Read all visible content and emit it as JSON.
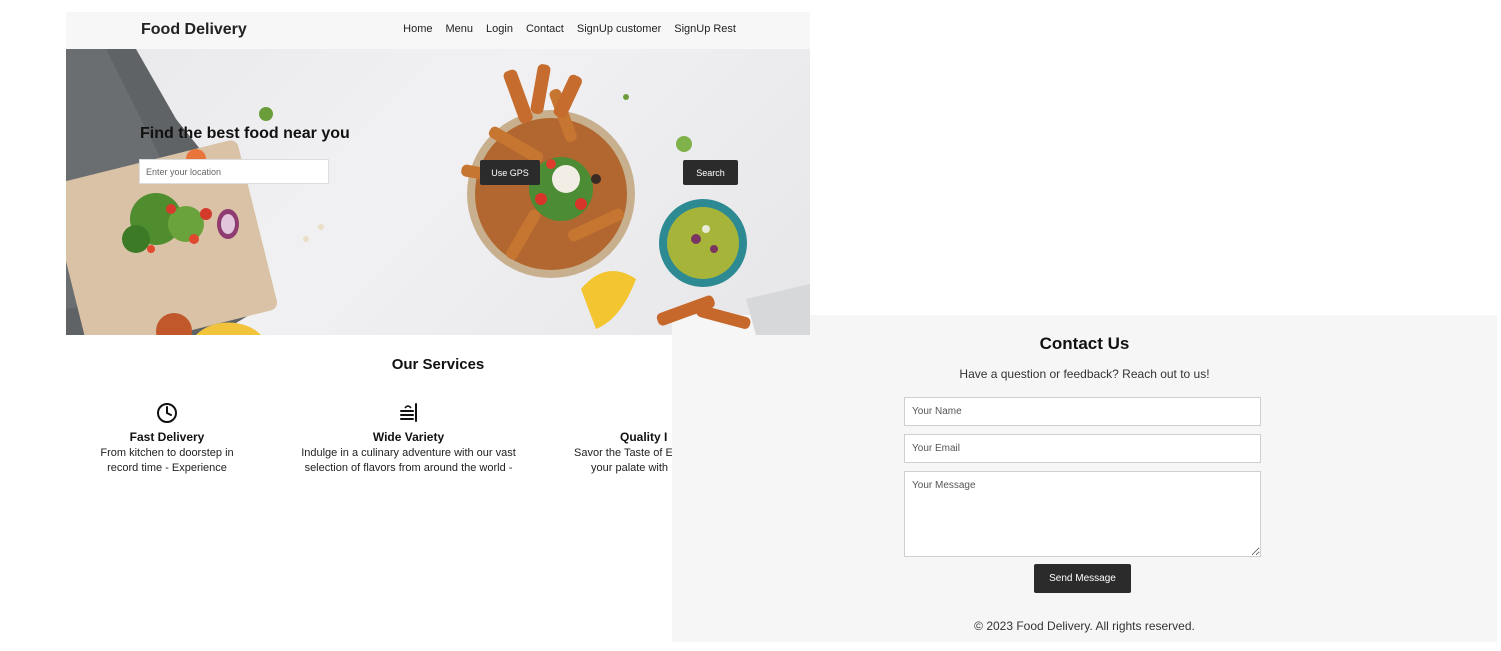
{
  "navbar": {
    "brand": "Food Delivery",
    "links": [
      "Home",
      "Menu",
      "Login",
      "Contact",
      "SignUp customer",
      "SignUp Rest"
    ]
  },
  "hero": {
    "title": "Find the best food near you",
    "location_placeholder": "Enter your location",
    "gps_button": "Use GPS",
    "search_button": "Search"
  },
  "services": {
    "title": "Our Services",
    "items": [
      {
        "icon": "clock-icon",
        "title": "Fast Delivery",
        "desc": [
          "From kitchen to doorstep in",
          "record time - Experience"
        ]
      },
      {
        "icon": "menu-icon",
        "title": "Wide Variety",
        "desc": [
          "Indulge in a culinary adventure with our vast",
          "selection of flavors from around the world -"
        ]
      },
      {
        "icon": "quality-icon",
        "title": "Quality I",
        "desc": [
          "Savor the Taste of E",
          "your palate with"
        ]
      }
    ]
  },
  "contact": {
    "title": "Contact Us",
    "subtitle": "Have a question or feedback? Reach out to us!",
    "name_placeholder": "Your Name",
    "email_placeholder": "Your Email",
    "message_placeholder": "Your Message",
    "send_button": "Send Message",
    "copyright": "© 2023 Food Delivery. All rights reserved."
  }
}
